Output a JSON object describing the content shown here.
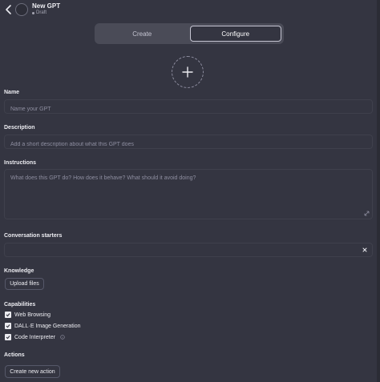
{
  "header": {
    "title": "New GPT",
    "status": "Draft"
  },
  "tabs": [
    {
      "label": "Create",
      "active": false
    },
    {
      "label": "Configure",
      "active": true
    }
  ],
  "fields": {
    "name": {
      "label": "Name",
      "placeholder": "Name your GPT",
      "value": ""
    },
    "description": {
      "label": "Description",
      "placeholder": "Add a short description about what this GPT does",
      "value": ""
    },
    "instructions": {
      "label": "Instructions",
      "placeholder": "What does this GPT do? How does it behave? What should it avoid doing?",
      "value": ""
    },
    "starters": {
      "label": "Conversation starters",
      "value": ""
    }
  },
  "knowledge": {
    "label": "Knowledge",
    "upload_label": "Upload files"
  },
  "capabilities": {
    "label": "Capabilities",
    "items": [
      {
        "label": "Web Browsing",
        "checked": true
      },
      {
        "label": "DALL·E Image Generation",
        "checked": true
      },
      {
        "label": "Code Interpreter",
        "checked": true
      }
    ]
  },
  "actions": {
    "label": "Actions",
    "create_label": "Create new action"
  },
  "colors": {
    "background": "#343541",
    "text": "#ececf1",
    "muted": "#8e8ea0"
  }
}
